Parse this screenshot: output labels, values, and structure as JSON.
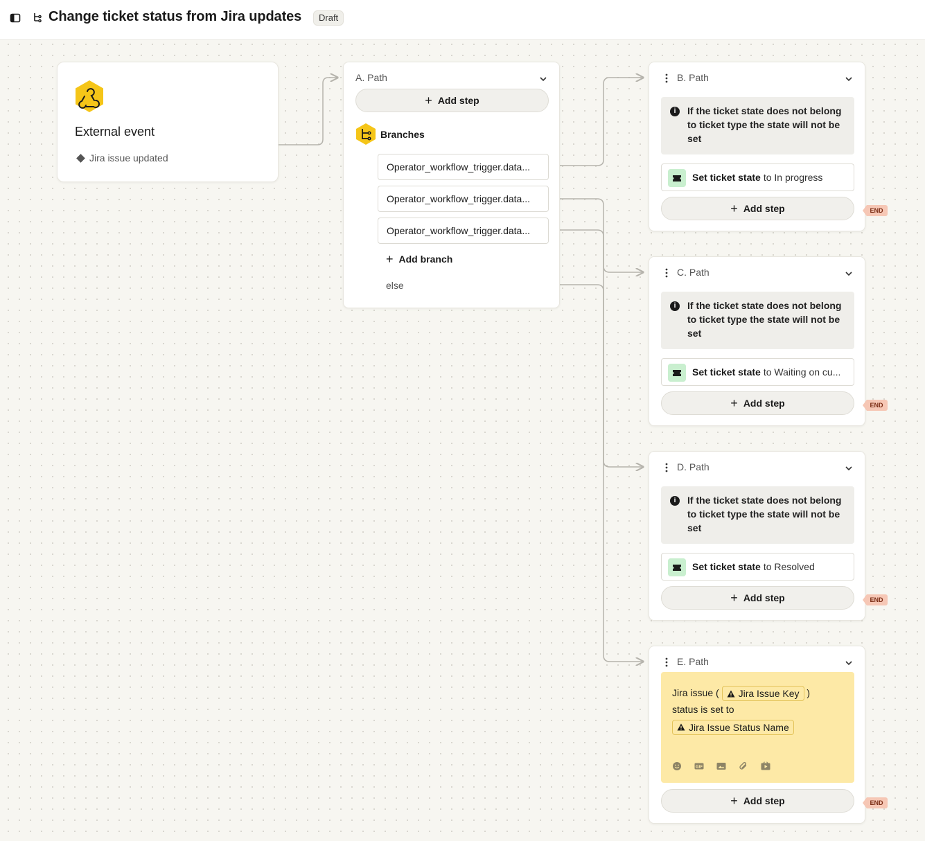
{
  "header": {
    "title": "Change ticket status from Jira updates",
    "status_badge": "Draft"
  },
  "trigger": {
    "title": "External event",
    "subtitle": "Jira issue updated",
    "icon": "webhook-icon",
    "accent": "#f5c518"
  },
  "path_a": {
    "label": "A. Path",
    "add_step": "Add step",
    "branches_label": "Branches",
    "branches": [
      "Operator_workflow_trigger.data...",
      "Operator_workflow_trigger.data...",
      "Operator_workflow_trigger.data..."
    ],
    "add_branch": "Add branch",
    "else_label": "else"
  },
  "paths": [
    {
      "label": "B. Path",
      "info": "If the ticket state does not belong to ticket type the state will not be set",
      "action_prefix": "Set ticket state",
      "action_suffix": "to In progress",
      "add_step": "Add step",
      "end": "END"
    },
    {
      "label": "C. Path",
      "info": "If the ticket state does not belong to ticket type the state will not be set",
      "action_prefix": "Set ticket state",
      "action_suffix": "to Waiting on cu...",
      "add_step": "Add step",
      "end": "END"
    },
    {
      "label": "D. Path",
      "info": "If the ticket state does not belong to ticket type the state will not be set",
      "action_prefix": "Set ticket state",
      "action_suffix": "to Resolved",
      "add_step": "Add step",
      "end": "END"
    }
  ],
  "path_e": {
    "label": "E. Path",
    "text_before": "Jira issue (",
    "chip_key": "Jira Issue Key",
    "text_after": ")",
    "text_line2": "status is set to",
    "chip_status": "Jira Issue Status Name",
    "composer_icons": [
      "emoji-icon",
      "gif-icon",
      "image-icon",
      "attachment-icon",
      "video-icon"
    ],
    "add_step": "Add step",
    "end": "END"
  },
  "colors": {
    "accent_yellow": "#f5c518",
    "end_tag": "#f6c7b5",
    "ticket_icon_bg": "#c9efcf",
    "message_bg": "#fde9a6"
  }
}
